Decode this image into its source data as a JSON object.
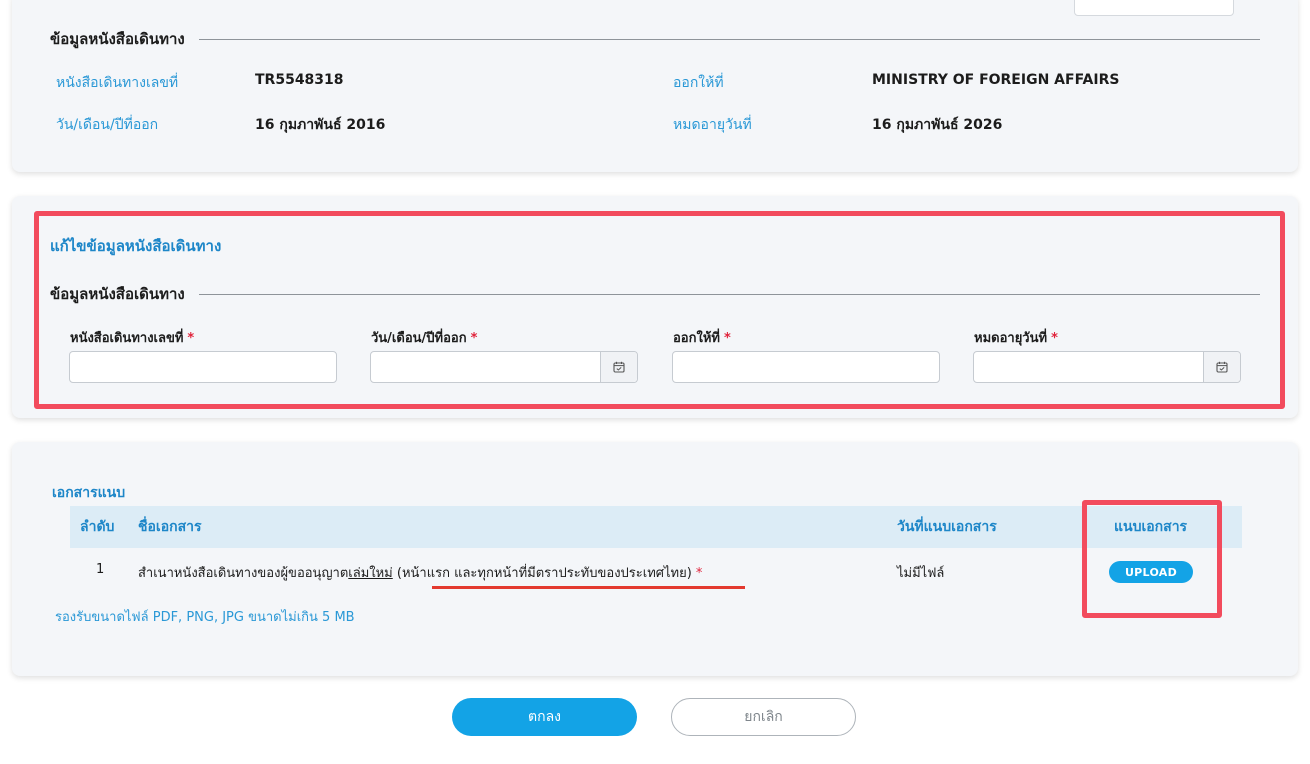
{
  "passport_info": {
    "section_title": "ข้อมูลหนังสือเดินทาง",
    "number_label": "หนังสือเดินทางเลขที่",
    "number_value": "TR5548318",
    "issued_by_label": "ออกให้ที่",
    "issued_by_value": "MINISTRY OF FOREIGN AFFAIRS",
    "issue_date_label": "วัน/เดือน/ปีที่ออก",
    "issue_date_value": "16 กุมภาพันธ์ 2016",
    "expiry_label": "หมดอายุวันที่",
    "expiry_value": "16 กุมภาพันธ์ 2026"
  },
  "edit_form": {
    "title": "แก้ไขข้อมูลหนังสือเดินทาง",
    "section_title": "ข้อมูลหนังสือเดินทาง",
    "required_mark": "*",
    "fields": [
      {
        "label": "หนังสือเดินทางเลขที่",
        "value": "",
        "icon": null
      },
      {
        "label": "วัน/เดือน/ปีที่ออก",
        "value": "",
        "icon": "calendar-icon"
      },
      {
        "label": "ออกให้ที่",
        "value": "",
        "icon": null
      },
      {
        "label": "หมดอายุวันที่",
        "value": "",
        "icon": "calendar-icon"
      }
    ]
  },
  "attachments": {
    "title": "เอกสารแนบ",
    "columns": {
      "no": "ลำดับ",
      "name": "ชื่อเอกสาร",
      "date": "วันที่แนบเอกสาร",
      "attach": "แนบเอกสาร"
    },
    "rows": [
      {
        "no": "1",
        "name_part1": "สำเนาหนังสือเดินทางของผู้ขออนุญาต",
        "name_underlined": "เล่มใหม่",
        "name_part2": " (หน้าแรก และทุกหน้าที่มีตราประทับของประเทศไทย)",
        "required_mark": "*",
        "date": "ไม่มีไฟล์",
        "upload_label": "UPLOAD"
      }
    ],
    "note": "รองรับขนาดไฟล์ PDF, PNG, JPG ขนาดไม่เกิน 5 MB"
  },
  "actions": {
    "ok": "ตกลง",
    "cancel": "ยกเลิก"
  },
  "colors": {
    "accent": "#13a3e6",
    "highlight": "#f24b5d",
    "label_blue": "#2a98d6"
  }
}
